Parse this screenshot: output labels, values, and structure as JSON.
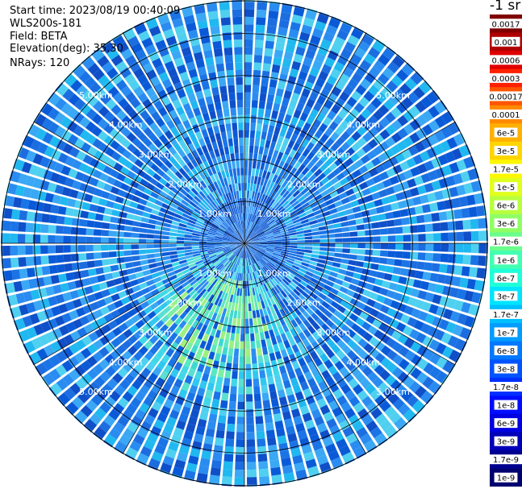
{
  "info": {
    "start_time": "Start time: 2023/08/19 00:40:09",
    "instrument": "WLS200s-181",
    "field": "Field: BETA",
    "elevation": "Elevation(deg): 35.30",
    "nrays": "NRays: 120"
  },
  "colorbar": {
    "unit_label": "-1 sr",
    "ticks": [
      "0.0017",
      "0.001",
      "0.0006",
      "0.0003",
      "0.00017",
      "0.0001",
      "6e-5",
      "3e-5",
      "1.7e-5",
      "1e-5",
      "6e-6",
      "3e-6",
      "1.7e-6",
      "1e-6",
      "6e-7",
      "3e-7",
      "1.7e-7",
      "1e-7",
      "6e-8",
      "3e-8",
      "1.7e-8",
      "1e-8",
      "6e-9",
      "3e-9",
      "1.7e-9",
      "1e-9"
    ],
    "colors": [
      "#800000",
      "#b00000",
      "#e00000",
      "#ff2000",
      "#ff5500",
      "#ff8a00",
      "#ffb000",
      "#ffd500",
      "#fff700",
      "#e0ff1e",
      "#b8ff3f",
      "#90ff66",
      "#6aff8c",
      "#44ffb2",
      "#1fffd8",
      "#00e4ff",
      "#00c0ff",
      "#009cff",
      "#0078ff",
      "#0054ff",
      "#0030ff",
      "#000cff",
      "#0000e0",
      "#0000b8",
      "#000090",
      "#000070"
    ]
  },
  "chart_data": {
    "type": "ppi-polar",
    "field": "BETA",
    "nrays": 120,
    "range_km": [
      0,
      5.8
    ],
    "ring_labels_km": [
      "1.00km",
      "2.00km",
      "3.00km",
      "4.00km",
      "5.00km"
    ],
    "ring_values_km": [
      1,
      2,
      3,
      4,
      5
    ],
    "radial_lines_deg": [
      0,
      30,
      60,
      90,
      120,
      150,
      180,
      210,
      240,
      270,
      300,
      330
    ],
    "color_scale": "log",
    "value_range": [
      1e-09,
      0.0017
    ],
    "description_note": ""
  }
}
